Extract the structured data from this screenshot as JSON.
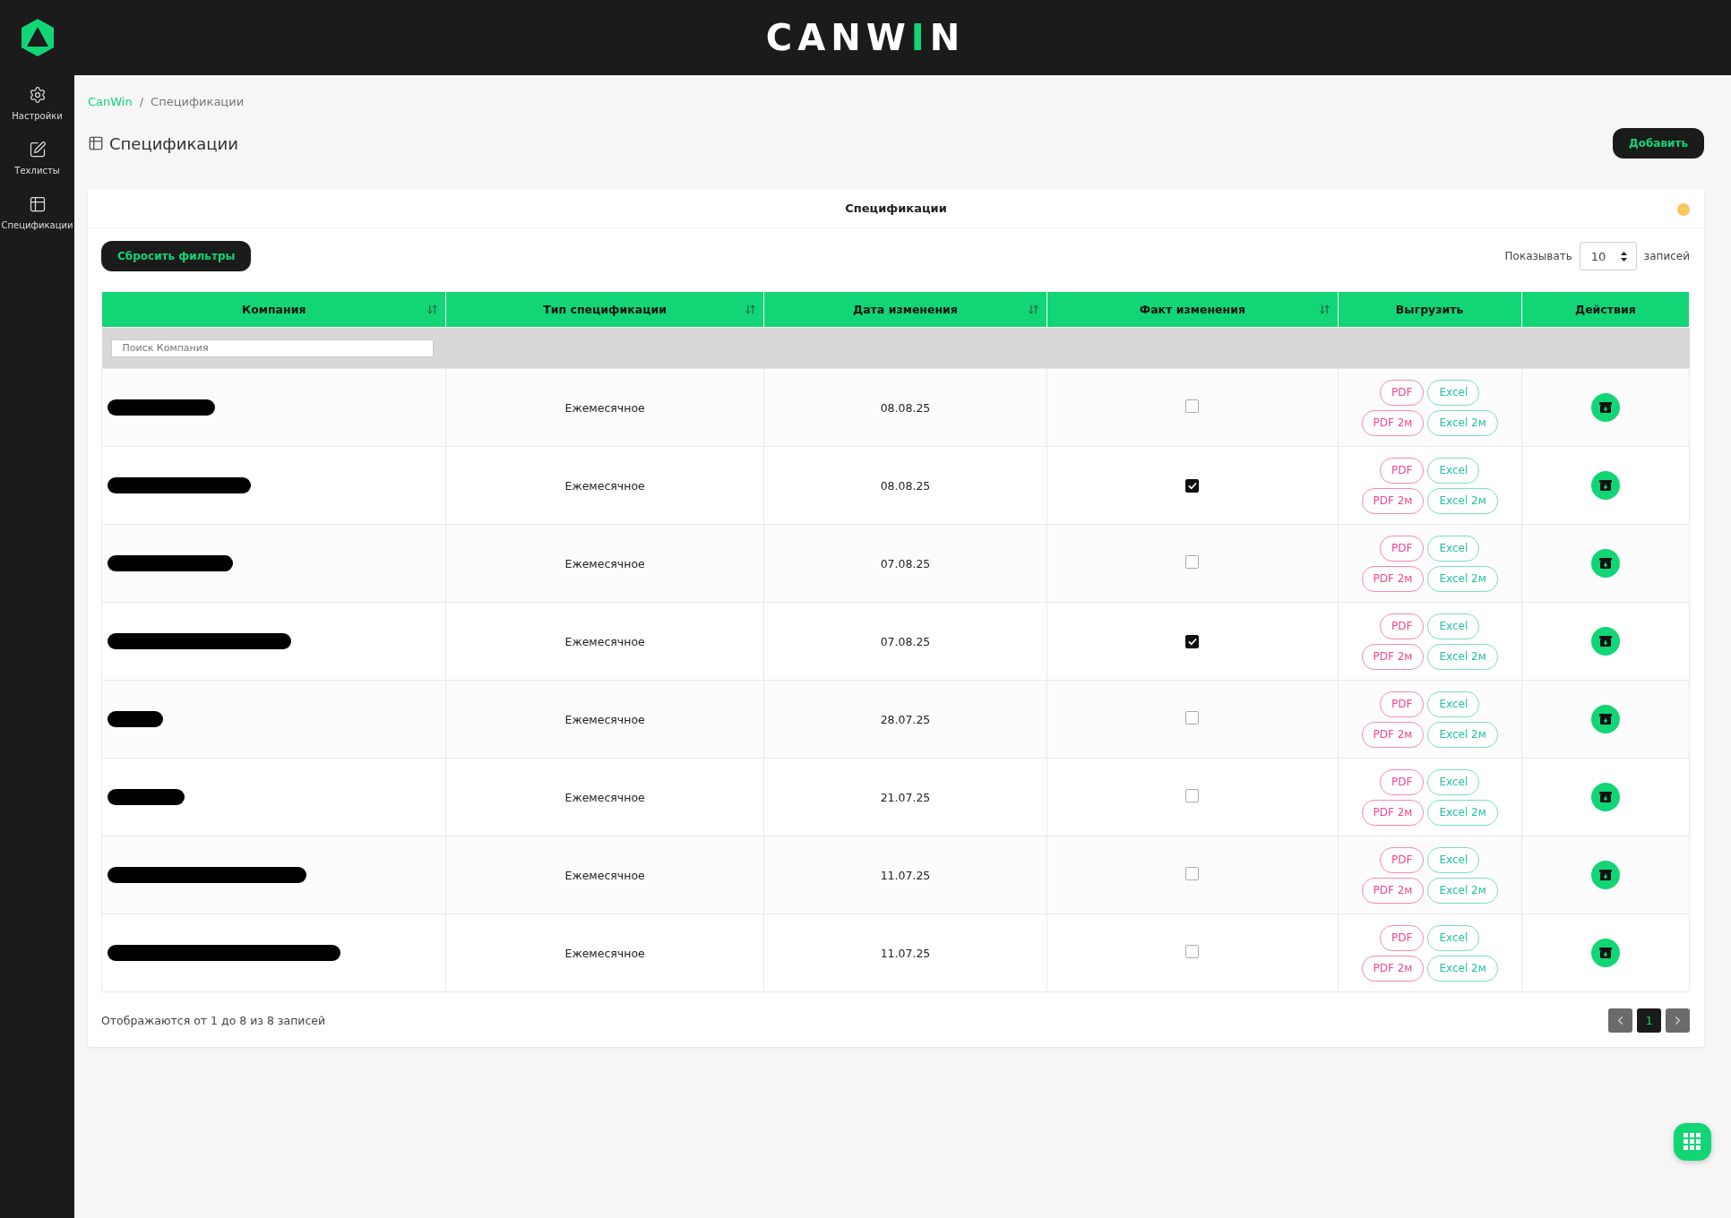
{
  "logo": {
    "parts": [
      {
        "text": "CANW",
        "accent": false
      },
      {
        "text": "I",
        "accent": true
      },
      {
        "text": "N",
        "accent": false
      }
    ]
  },
  "sidebar": {
    "items": [
      {
        "label": "Настройки",
        "selected": false
      },
      {
        "label": "Техлисты",
        "selected": false
      },
      {
        "label": "Спецификации",
        "selected": false
      }
    ]
  },
  "breadcrumb": [
    {
      "label": "CanWin",
      "kind": "link"
    },
    {
      "label": "Спецификации",
      "kind": "current"
    }
  ],
  "breadcrumb_separator": "/",
  "page_title": "Спецификации",
  "add_button": "Добавить",
  "card": {
    "title": "Спецификации",
    "reset_button": "Сбросить фильтры",
    "page_size": {
      "prefix": "Показывать",
      "value": "10",
      "suffix": "записей"
    },
    "table": {
      "columns": [
        {
          "label": "Компания",
          "sortable": true
        },
        {
          "label": "Тип спецификации",
          "sortable": true
        },
        {
          "label": "Дата изменения",
          "sortable": true
        },
        {
          "label": "Факт изменения",
          "sortable": true
        },
        {
          "label": "Выгрузить",
          "sortable": false
        },
        {
          "label": "Действия",
          "sortable": false
        }
      ],
      "search": {
        "placeholder": "Поиск Компания"
      },
      "rows": [
        {
          "company_redacted": true,
          "type": "Ежемесячное",
          "date": "08.08.25",
          "fact_changed": false,
          "exports": [
            {
              "label": "PDF",
              "kind": "pdf"
            },
            {
              "label": "Excel",
              "kind": "excel"
            },
            {
              "label": "PDF 2м",
              "kind": "pdf"
            },
            {
              "label": "Excel 2м",
              "kind": "excel"
            }
          ]
        },
        {
          "company_redacted": true,
          "type": "Ежемесячное",
          "date": "08.08.25",
          "fact_changed": true,
          "exports": [
            {
              "label": "PDF",
              "kind": "pdf"
            },
            {
              "label": "Excel",
              "kind": "excel"
            },
            {
              "label": "PDF 2м",
              "kind": "pdf"
            },
            {
              "label": "Excel 2м",
              "kind": "excel"
            }
          ]
        },
        {
          "company_redacted": true,
          "type": "Ежемесячное",
          "date": "07.08.25",
          "fact_changed": false,
          "exports": [
            {
              "label": "PDF",
              "kind": "pdf"
            },
            {
              "label": "Excel",
              "kind": "excel"
            },
            {
              "label": "PDF 2м",
              "kind": "pdf"
            },
            {
              "label": "Excel 2м",
              "kind": "excel"
            }
          ]
        },
        {
          "company_redacted": true,
          "type": "Ежемесячное",
          "date": "07.08.25",
          "fact_changed": true,
          "exports": [
            {
              "label": "PDF",
              "kind": "pdf"
            },
            {
              "label": "Excel",
              "kind": "excel"
            },
            {
              "label": "PDF 2м",
              "kind": "pdf"
            },
            {
              "label": "Excel 2м",
              "kind": "excel"
            }
          ]
        },
        {
          "company_redacted": true,
          "type": "Ежемесячное",
          "date": "28.07.25",
          "fact_changed": false,
          "exports": [
            {
              "label": "PDF",
              "kind": "pdf"
            },
            {
              "label": "Excel",
              "kind": "excel"
            },
            {
              "label": "PDF 2м",
              "kind": "pdf"
            },
            {
              "label": "Excel 2м",
              "kind": "excel"
            }
          ]
        },
        {
          "company_redacted": true,
          "type": "Ежемесячное",
          "date": "21.07.25",
          "fact_changed": false,
          "exports": [
            {
              "label": "PDF",
              "kind": "pdf"
            },
            {
              "label": "Excel",
              "kind": "excel"
            },
            {
              "label": "PDF 2м",
              "kind": "pdf"
            },
            {
              "label": "Excel 2м",
              "kind": "excel"
            }
          ]
        },
        {
          "company_redacted": true,
          "type": "Ежемесячное",
          "date": "11.07.25",
          "fact_changed": false,
          "exports": [
            {
              "label": "PDF",
              "kind": "pdf"
            },
            {
              "label": "Excel",
              "kind": "excel"
            },
            {
              "label": "PDF 2м",
              "kind": "pdf"
            },
            {
              "label": "Excel 2м",
              "kind": "excel"
            }
          ]
        },
        {
          "company_redacted": true,
          "type": "Ежемесячное",
          "date": "11.07.25",
          "fact_changed": false,
          "exports": [
            {
              "label": "PDF",
              "kind": "pdf"
            },
            {
              "label": "Excel",
              "kind": "excel"
            },
            {
              "label": "PDF 2м",
              "kind": "pdf"
            },
            {
              "label": "Excel 2м",
              "kind": "excel"
            }
          ]
        }
      ]
    },
    "footer_info": "Отображаются от 1 до 8 из 8 записей",
    "pages": [
      {
        "label": "1",
        "selected": true
      }
    ]
  }
}
